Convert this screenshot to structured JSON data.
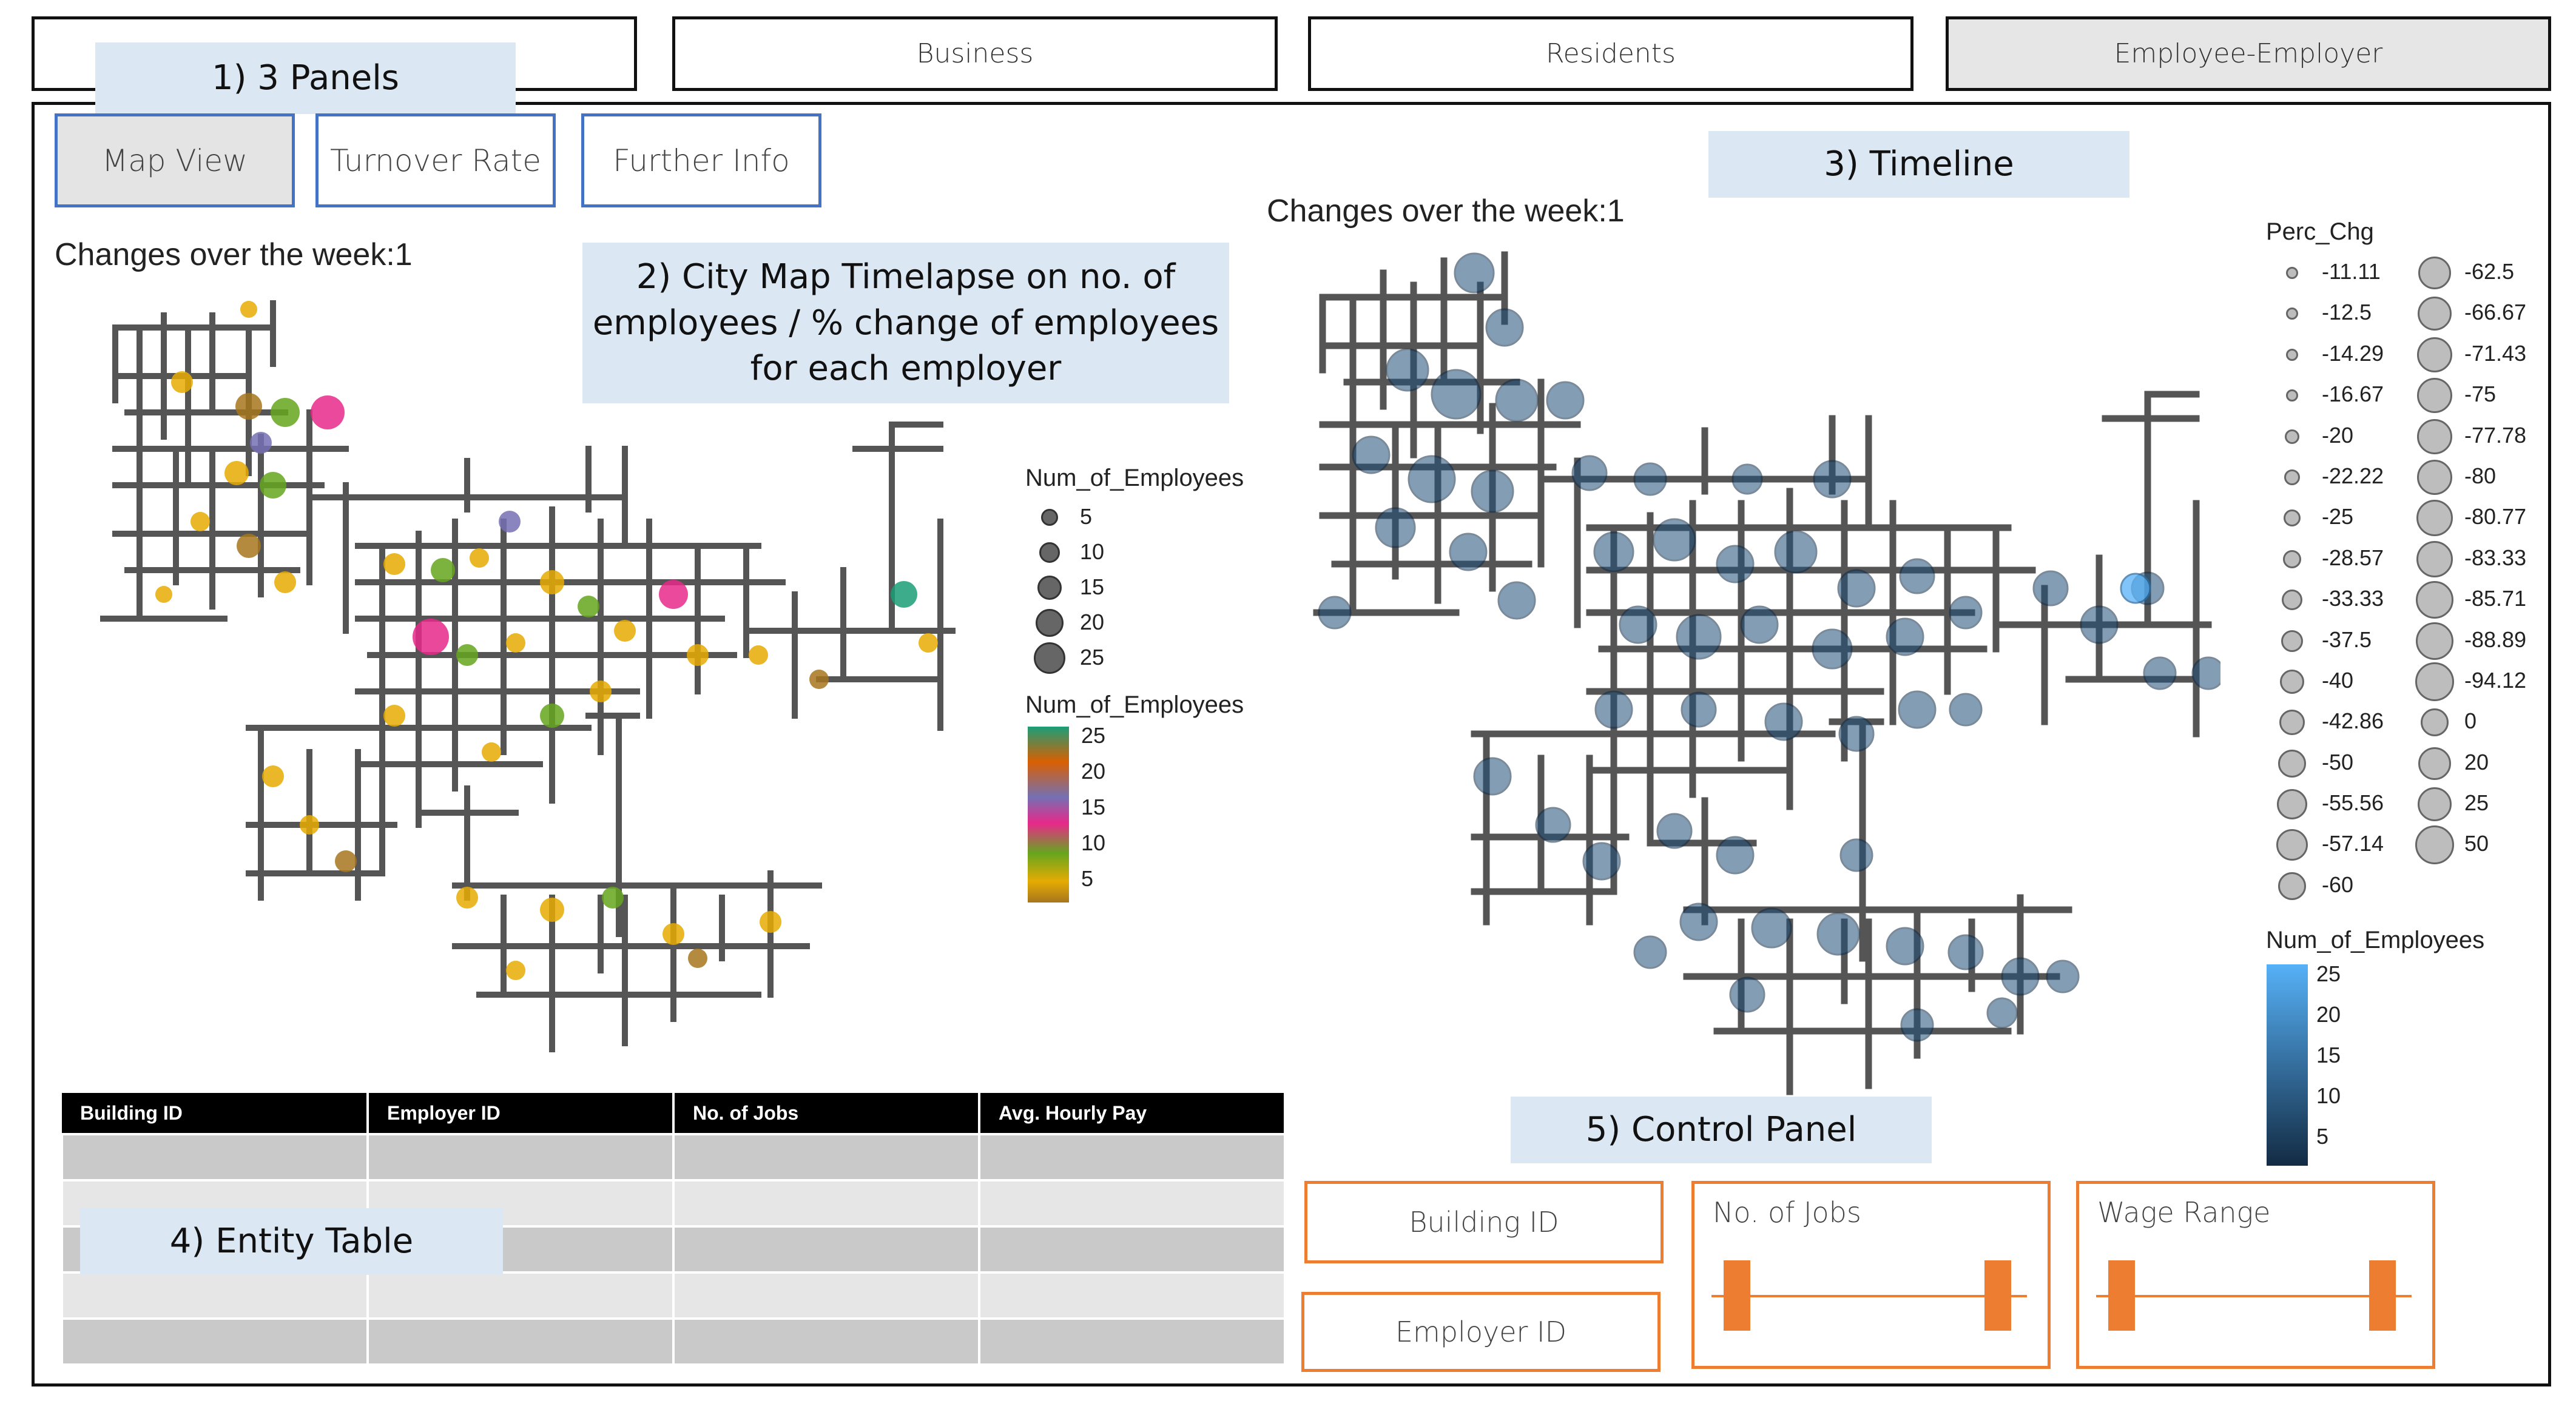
{
  "top_tabs": [
    {
      "label": "",
      "active": false
    },
    {
      "label": "Business",
      "active": false
    },
    {
      "label": "Residents",
      "active": false
    },
    {
      "label": "Employee-Employer",
      "active": true
    }
  ],
  "sub_tabs": [
    {
      "label": "Map View",
      "active": true
    },
    {
      "label": "Turnover Rate",
      "active": false
    },
    {
      "label": "Further Info",
      "active": false
    }
  ],
  "callouts": {
    "panels": "1) 3 Panels",
    "map_line1": "2) City Map Timelapse on no. of",
    "map_line2": "employees / % change of employees",
    "map_line3": "for each employer",
    "timeline": "3) Timeline",
    "entity_table": "4) Entity Table",
    "control_panel": "5) Control Panel"
  },
  "left_map": {
    "title": "Changes over the week:1",
    "size_legend_title": "Num_of_Employees",
    "size_legend": [
      "5",
      "10",
      "15",
      "20",
      "25"
    ],
    "color_legend_title": "Num_of_Employees",
    "color_legend": [
      "25",
      "20",
      "15",
      "10",
      "5"
    ],
    "color_scale": [
      "#1b9e77",
      "#d95f02",
      "#7570b3",
      "#e7298a",
      "#66a61e",
      "#e6ab02",
      "#a6761d"
    ]
  },
  "right_map": {
    "title": "Changes over the week:1",
    "perc_legend_title": "Perc_Chg",
    "perc_col1": [
      "-11.11",
      "-12.5",
      "-14.29",
      "-16.67",
      "-20",
      "-22.22",
      "-25",
      "-28.57",
      "-33.33",
      "-37.5",
      "-40",
      "-42.86",
      "-50",
      "-55.56",
      "-57.14",
      "-60"
    ],
    "perc_col2": [
      "-62.5",
      "-66.67",
      "-71.43",
      "-75",
      "-77.78",
      "-80",
      "-80.77",
      "-83.33",
      "-85.71",
      "-88.89",
      "-94.12",
      "0",
      "20",
      "25",
      "50"
    ],
    "color_legend_title": "Num_of_Employees",
    "color_legend": [
      "25",
      "20",
      "15",
      "10",
      "5"
    ],
    "color_scale": [
      "#56b1f7",
      "#132b43"
    ]
  },
  "table": {
    "headers": [
      "Building ID",
      "Employer ID",
      "No. of Jobs",
      "Avg. Hourly Pay"
    ],
    "rows": 5
  },
  "controls": {
    "building_id": "Building ID",
    "employer_id": "Employer ID",
    "no_of_jobs": "No. of Jobs",
    "wage_range": "Wage Range",
    "accent": "#ed7d31"
  }
}
